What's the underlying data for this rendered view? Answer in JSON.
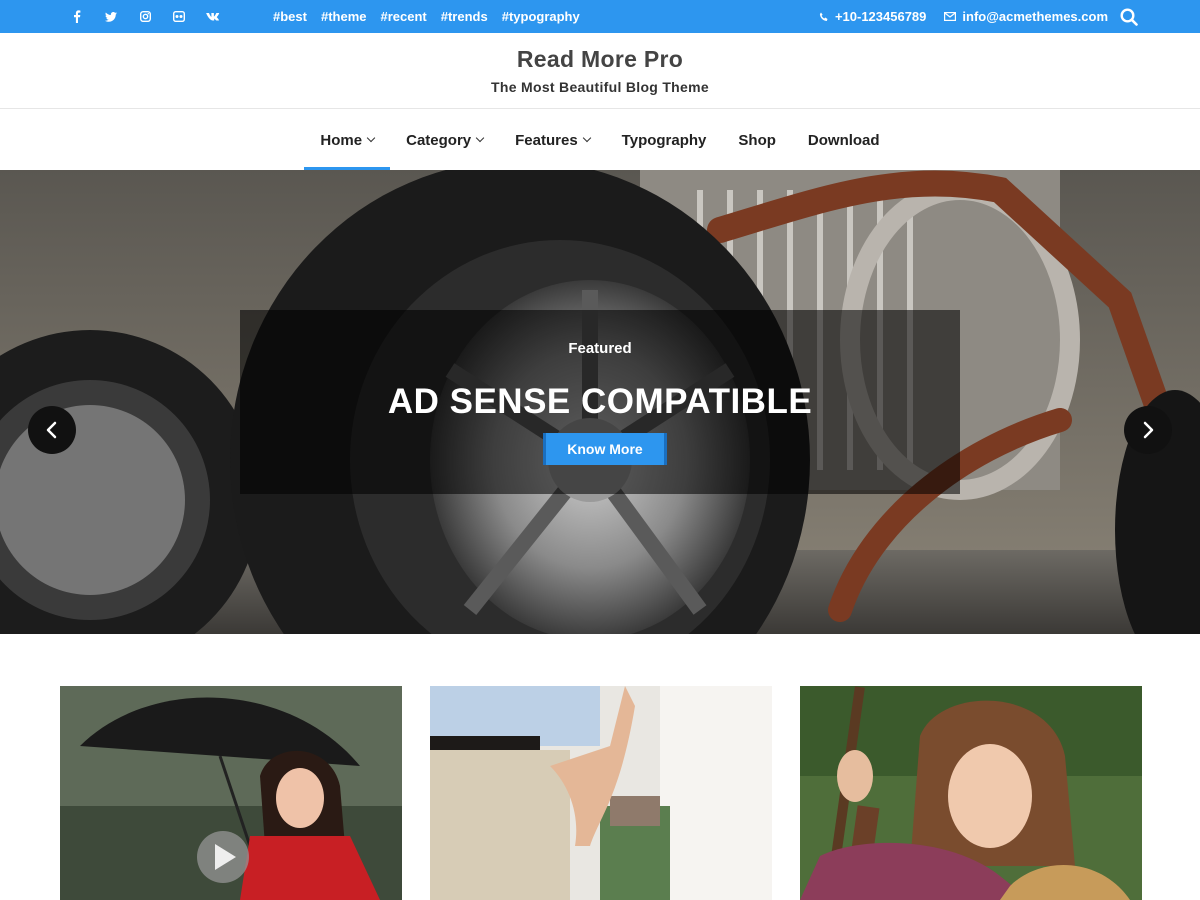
{
  "topbar": {
    "social": [
      {
        "icon": "facebook-icon",
        "glyph": "f"
      },
      {
        "icon": "twitter-icon",
        "glyph": "t"
      },
      {
        "icon": "instagram-icon",
        "glyph": ""
      },
      {
        "icon": "flickr-icon",
        "glyph": ""
      },
      {
        "icon": "vk-icon",
        "glyph": "vk"
      }
    ],
    "tags": [
      "#best",
      "#theme",
      "#recent",
      "#trends",
      "#typography"
    ],
    "phone": "+10-123456789",
    "email": "info@acmethemes.com",
    "accent_color": "#2d96ef"
  },
  "brand": {
    "site_title": "Read More Pro",
    "tagline": "The Most Beautiful Blog Theme"
  },
  "nav": {
    "items": [
      {
        "label": "Home",
        "dropdown": true,
        "active": true
      },
      {
        "label": "Category",
        "dropdown": true,
        "active": false
      },
      {
        "label": "Features",
        "dropdown": true,
        "active": false
      },
      {
        "label": "Typography",
        "dropdown": false,
        "active": false
      },
      {
        "label": "Shop",
        "dropdown": false,
        "active": false
      },
      {
        "label": "Download",
        "dropdown": false,
        "active": false
      }
    ]
  },
  "slider": {
    "category": "Featured",
    "title": "AD SENSE COMPATIBLE",
    "button": "Know More"
  },
  "posts": [
    {
      "image": "woman-with-umbrella",
      "has_video": true
    },
    {
      "image": "couple-holding-hands",
      "has_video": false
    },
    {
      "image": "girl-with-rifle-and-dog",
      "has_video": false
    }
  ]
}
